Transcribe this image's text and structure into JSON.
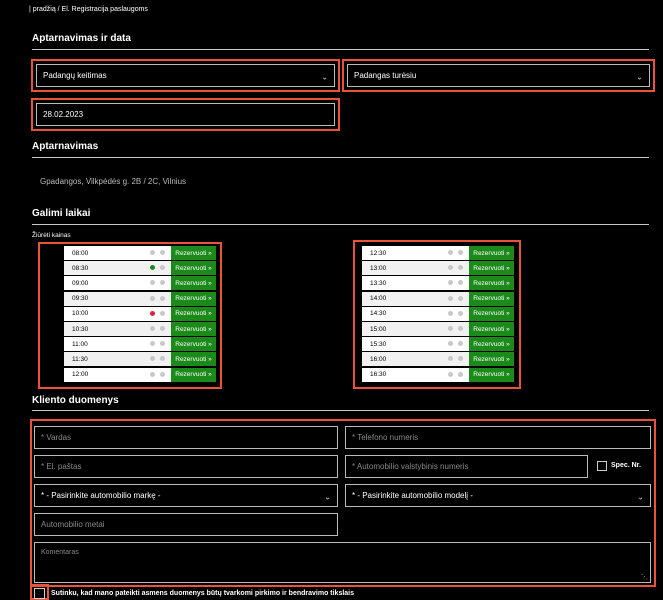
{
  "breadcrumb": "| pradžią / El. Registracija paslaugoms",
  "sections": {
    "service_date": "Aptarnavimas ir data",
    "service": "Aptarnavimas",
    "available_times": "Galimi laikai",
    "client_data": "Kliento duomenys"
  },
  "service_select": {
    "value": "Padangų keitimas"
  },
  "tires_select": {
    "value": "Padangas turėsiu"
  },
  "date_input": {
    "value": "28.02.2023"
  },
  "address": "Gpadangos, Vilkpėdės g. 2B / 2C, Vilnius",
  "prices_link": "Žiūrėti kainas",
  "reserve_label": "Rezervuoti »",
  "slots_left": [
    {
      "time": "08:00",
      "dot1": "#c8c8c8",
      "dot2": "#c8c8c8"
    },
    {
      "time": "08:30",
      "dot1": "#1b8a1b",
      "dot2": "#c8c8c8"
    },
    {
      "time": "09:00",
      "dot1": "#c8c8c8",
      "dot2": "#c8c8c8"
    },
    {
      "time": "09:30",
      "dot1": "#c8c8c8",
      "dot2": "#c8c8c8"
    },
    {
      "time": "10:00",
      "dot1": "#e0223a",
      "dot2": "#c8c8c8"
    },
    {
      "time": "10:30",
      "dot1": "#c8c8c8",
      "dot2": "#c8c8c8"
    },
    {
      "time": "11:00",
      "dot1": "#c8c8c8",
      "dot2": "#c8c8c8"
    },
    {
      "time": "11:30",
      "dot1": "#c8c8c8",
      "dot2": "#c8c8c8"
    },
    {
      "time": "12:00",
      "dot1": "#c8c8c8",
      "dot2": "#c8c8c8"
    }
  ],
  "slots_right": [
    {
      "time": "12:30",
      "dot1": "#c8c8c8",
      "dot2": "#c8c8c8"
    },
    {
      "time": "13:00",
      "dot1": "#c8c8c8",
      "dot2": "#c8c8c8"
    },
    {
      "time": "13:30",
      "dot1": "#c8c8c8",
      "dot2": "#c8c8c8"
    },
    {
      "time": "14:00",
      "dot1": "#c8c8c8",
      "dot2": "#c8c8c8"
    },
    {
      "time": "14:30",
      "dot1": "#c8c8c8",
      "dot2": "#c8c8c8"
    },
    {
      "time": "15:00",
      "dot1": "#c8c8c8",
      "dot2": "#c8c8c8"
    },
    {
      "time": "15:30",
      "dot1": "#c8c8c8",
      "dot2": "#c8c8c8"
    },
    {
      "time": "16:00",
      "dot1": "#c8c8c8",
      "dot2": "#c8c8c8"
    },
    {
      "time": "16:30",
      "dot1": "#c8c8c8",
      "dot2": "#c8c8c8"
    }
  ],
  "form": {
    "name_placeholder": "* Vardas",
    "phone_placeholder": "* Telefono numeris",
    "email_placeholder": "* El. paštas",
    "plate_placeholder": "* Automobilio valstybinis numeris",
    "spec_label": "Spec. Nr.",
    "make_select": "* - Pasirinkite automobilio markę -",
    "model_select": "* - Pasirinkite automobilio modelį -",
    "year_placeholder": "Automobilio metai",
    "comment_placeholder": "Komentaras"
  },
  "consent_text": "Sutinku, kad mano pateikti asmens duomenys būtų tvarkomi pirkimo ir bendravimo tikslais",
  "colors": {
    "highlight": "#e8533a",
    "reserve_green": "#1b8a1b"
  }
}
